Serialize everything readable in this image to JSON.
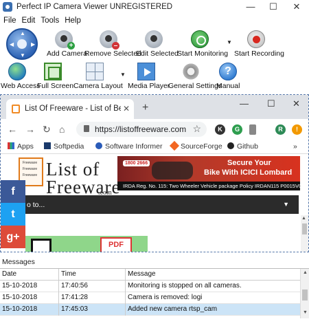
{
  "window": {
    "title": "Perfect IP Camera Viewer UNREGISTERED",
    "minimize": "—",
    "maximize": "☐",
    "close": "✕"
  },
  "menu": {
    "items": [
      "File",
      "Edit",
      "Tools",
      "Help"
    ]
  },
  "toolbar": {
    "row1": [
      "Add Camera",
      "Remove Selected",
      "Edit Selected",
      "Start Monitoring",
      "Start Recording"
    ],
    "row2": [
      "Web Access",
      "Full Screen",
      "Camera Layout",
      "Media Player",
      "General Settings",
      "Manual"
    ],
    "dropdown_glyph": "▼",
    "badge_add": "+",
    "badge_remove": "–",
    "help_glyph": "?"
  },
  "browser": {
    "tab_title": "List Of Freeware - List of Best Free",
    "tab_close": "✕",
    "new_tab": "+",
    "win_min": "—",
    "win_max": "☐",
    "win_close": "✕",
    "back": "←",
    "forward": "→",
    "reload": "↻",
    "home": "⌂",
    "url": "https://listoffreeware.com",
    "star": "☆",
    "extensions": [
      {
        "letter": "K",
        "color": "#333333"
      },
      {
        "letter": "G",
        "color": "#2e9e4f"
      },
      {
        "letter": "R",
        "color": "#2e8b57"
      },
      {
        "letter": "!",
        "color": "#f29900"
      }
    ],
    "menu_glyph": "⋮",
    "bookmarks": [
      "Apps",
      "Softpedia",
      "Software Informer",
      "SourceForge",
      "Github"
    ],
    "bookmarks_more": "»"
  },
  "page": {
    "logo_line1": "List of",
    "logo_line2": "Freeware",
    "logo_com": ".com",
    "logo_checklist": [
      "Freeware",
      "Freeware",
      "Freeware"
    ],
    "ad_phone": "1800 2666",
    "ad_line1": "Secure Your",
    "ad_line2": "Bike With ICICI Lombard",
    "ad_reg": "IRDA Reg. No. 115: Two Wheeler Vehicle package Policy IRDAN115 P0015V02201",
    "nav_text": "o to...",
    "nav_caret": "▼",
    "share": [
      "f",
      "t",
      "g+"
    ],
    "pdf_label": "PDF"
  },
  "messages": {
    "label": "Messages",
    "columns": [
      "Date",
      "Time",
      "Message"
    ],
    "rows": [
      {
        "date": "15-10-2018",
        "time": "17:40:56",
        "message": "Monitoring is stopped on all cameras."
      },
      {
        "date": "15-10-2018",
        "time": "17:41:28",
        "message": "Camera is removed: logi"
      },
      {
        "date": "15-10-2018",
        "time": "17:45:03",
        "message": "Added new camera rtsp_cam"
      }
    ],
    "selected_row": 2
  },
  "colors": {
    "accent": "#2e64b5",
    "selection": "#cce4f7",
    "facebook": "#3b5998",
    "twitter": "#1da1f2",
    "googleplus": "#dd4b39"
  }
}
